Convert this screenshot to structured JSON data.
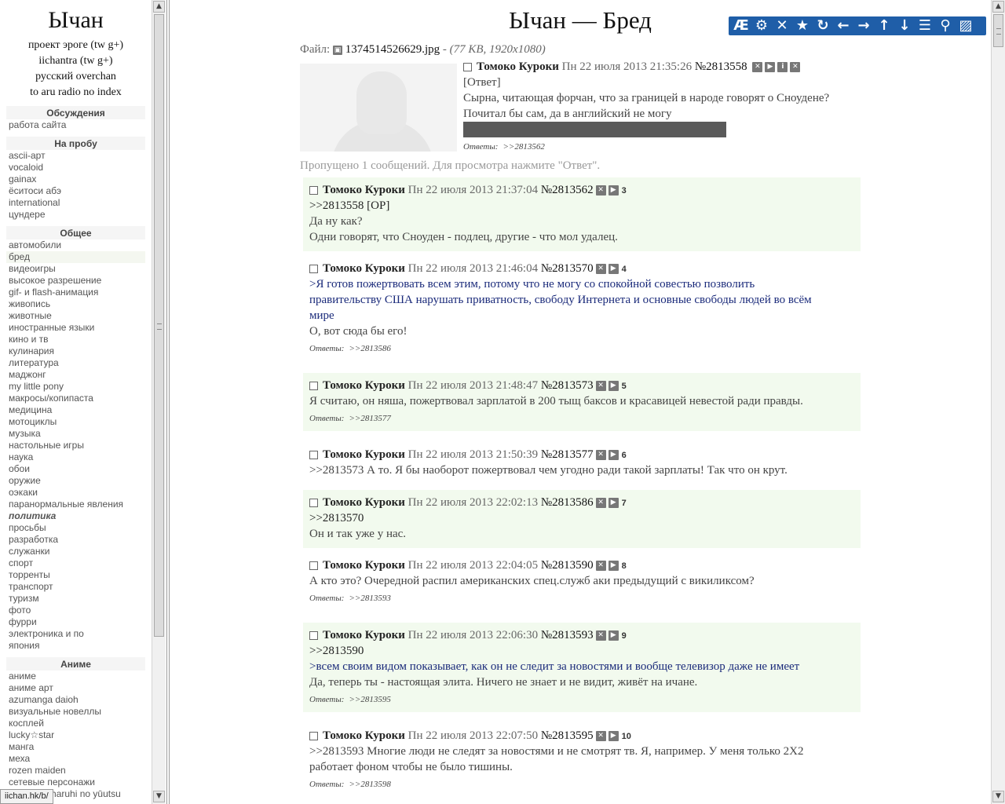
{
  "sidebar": {
    "logo": "Ычан",
    "top_links": [
      "проект эроге (tw g+)",
      "iichantra (tw g+)",
      "русский overchan",
      "to aru radio no index"
    ],
    "sections": [
      {
        "title": "Обсуждения",
        "items": [
          "работа сайта"
        ]
      },
      {
        "title": "На пробу",
        "items": [
          "ascii-арт",
          "vocaloid",
          "gainax",
          "ёситоси абэ",
          "international",
          "цундере"
        ]
      },
      {
        "title": "Общее",
        "items": [
          "автомобили",
          "бред",
          "видеоигры",
          "высокое разрешение",
          "gif- и flash-анимация",
          "живопись",
          "животные",
          "иностранные языки",
          "кино и тв",
          "кулинария",
          "литература",
          "маджонг",
          "my little pony",
          "макросы/копипаста",
          "медицина",
          "мотоциклы",
          "музыка",
          "настольные игры",
          "наука",
          "обои",
          "оружие",
          "оэкаки",
          "паранормальные явления",
          "политика",
          "просьбы",
          "разработка",
          "служанки",
          "спорт",
          "торренты",
          "транспорт",
          "туризм",
          "фото",
          "фурри",
          "электроника и по",
          "япония"
        ]
      },
      {
        "title": "Аниме",
        "items": [
          "аниме",
          "аниме арт",
          "azumanga daioh",
          "визуальные новеллы",
          "косплей",
          "lucky☆star",
          "манга",
          "меха",
          "rozen maiden",
          "сетевые персонажи",
          "suzumiya haruhi no yūutsu"
        ]
      }
    ],
    "active_item": "бред",
    "bold_item": "политика"
  },
  "status_url": "iichan.hk/b/",
  "board": {
    "title": "Ычан — Бред",
    "toolbar_icons": [
      "ae-icon",
      "gear-icon",
      "close-icon",
      "star-icon",
      "refresh-icon",
      "arrow-left-icon",
      "arrow-right-icon",
      "arrow-up-icon",
      "arrow-down-icon",
      "list-icon",
      "zoom-icon",
      "expand-icon"
    ]
  },
  "op": {
    "file_label": "Файл:",
    "file_name": "1374514526629.jpg",
    "file_sep": " - ",
    "file_meta": "(77 KB, 1920x1080)",
    "name": "Томоко Куроки",
    "date": "Пн 22 июля 2013 21:35:26",
    "number": "№2813558",
    "reply_label": "[Ответ]",
    "lines": [
      "Сырна, читающая форчан, что за границей в народе говорят о Сноудене?",
      "Почитал бы сам, да в английский не могу"
    ],
    "answers_label": "Ответы:",
    "answers": ">>2813562"
  },
  "omitted": "Пропущено 1 сообщений. Для просмотра нажмите \"Ответ\".",
  "replies": [
    {
      "name": "Томоко Куроки",
      "date": "Пн 22 июля 2013 21:37:04",
      "number": "№2813562",
      "index": "3",
      "lines": [
        {
          "t": ">>2813558 [OP]",
          "k": "link"
        },
        {
          "t": "Да ну как?",
          "k": "text"
        },
        {
          "t": "Одни говорят, что Сноуден - подлец, другие - что мол удалец.",
          "k": "text"
        }
      ],
      "answers": ""
    },
    {
      "name": "Томоко Куроки",
      "date": "Пн 22 июля 2013 21:46:04",
      "number": "№2813570",
      "index": "4",
      "lines": [
        {
          "t": ">Я готов пожертвовать всем этим, потому что не могу со спокойной совестью позволить",
          "k": "quote"
        },
        {
          "t": "правительству США нарушать приватность, свободу Интернета и основные свободы людей во всём",
          "k": "quote"
        },
        {
          "t": "мире",
          "k": "quote"
        },
        {
          "t": "О, вот сюда бы его!",
          "k": "text"
        }
      ],
      "answers": ">>2813586"
    },
    {
      "name": "Томоко Куроки",
      "date": "Пн 22 июля 2013 21:48:47",
      "number": "№2813573",
      "index": "5",
      "lines": [
        {
          "t": "Я считаю, он няша, пожертвовал зарплатой в 200 тыщ баксов и красавицей невестой ради правды.",
          "k": "text"
        }
      ],
      "answers": ">>2813577"
    },
    {
      "name": "Томоко Куроки",
      "date": "Пн 22 июля 2013 21:50:39",
      "number": "№2813577",
      "index": "6",
      "lines": [
        {
          "t": ">>2813573 А то. Я бы наоборот пожертвовал чем угодно ради такой зарплаты! Так что он крут.",
          "k": "text"
        }
      ],
      "answers": ""
    },
    {
      "name": "Томоко Куроки",
      "date": "Пн 22 июля 2013 22:02:13",
      "number": "№2813586",
      "index": "7",
      "lines": [
        {
          "t": ">>2813570",
          "k": "link"
        },
        {
          "t": "Он и так уже у нас.",
          "k": "text"
        }
      ],
      "answers": ""
    },
    {
      "name": "Томоко Куроки",
      "date": "Пн 22 июля 2013 22:04:05",
      "number": "№2813590",
      "index": "8",
      "lines": [
        {
          "t": "А кто это? Очередной распил американских спец.служб аки предыдущий с викиликсом?",
          "k": "text"
        }
      ],
      "answers": ">>2813593"
    },
    {
      "name": "Томоко Куроки",
      "date": "Пн 22 июля 2013 22:06:30",
      "number": "№2813593",
      "index": "9",
      "lines": [
        {
          "t": ">>2813590",
          "k": "link"
        },
        {
          "t": ">всем своим видом показывает, как он не следит за новостями и вообще телевизор даже не имеет",
          "k": "quote"
        },
        {
          "t": "Да, теперь ты - настоящая элита. Ничего не знает и не видит, живёт на ичане.",
          "k": "text"
        }
      ],
      "answers": ">>2813595"
    },
    {
      "name": "Томоко Куроки",
      "date": "Пн 22 июля 2013 22:07:50",
      "number": "№2813595",
      "index": "10",
      "lines": [
        {
          "t": ">>2813593 Многие люди не следят за новостями и не смотрят тв. Я, например. У меня только 2Х2",
          "k": "text"
        },
        {
          "t": "работает фоном чтобы не было тишины.",
          "k": "text"
        }
      ],
      "answers": ">>2813598"
    }
  ],
  "answers_label": "Ответы:"
}
